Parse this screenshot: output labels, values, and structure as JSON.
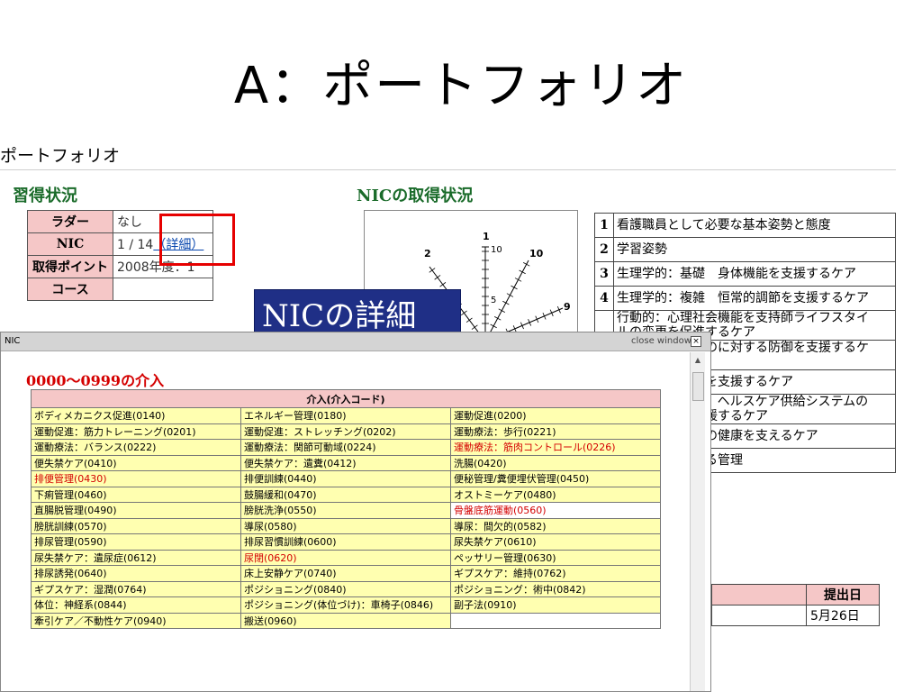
{
  "slide_title": "A：ポートフォリオ",
  "portfolio_heading": "ポートフォリオ",
  "status_heading": "習得状況",
  "status": {
    "rows": [
      {
        "label": "ラダー",
        "value": "なし"
      },
      {
        "label": "NIC",
        "value": "1 / 14",
        "link_text": "（詳細）"
      },
      {
        "label": "取得ポイント",
        "value": "2008年度：1"
      },
      {
        "label": "コース",
        "value": ""
      }
    ]
  },
  "nic_heading": "NICの取得状況",
  "chart_data": {
    "type": "radar",
    "axis_labels": [
      "1",
      "10",
      "9",
      "2"
    ],
    "tick_labels": [
      "10",
      "5"
    ]
  },
  "nic_list": [
    {
      "num": "1",
      "text": "看護職員として必要な基本姿勢と態度"
    },
    {
      "num": "2",
      "text": "学習姿勢"
    },
    {
      "num": "3",
      "text": "生理学的：基礎　身体機能を支援するケア"
    },
    {
      "num": "4",
      "text": "生理学的：複雑　恒常的調節を支援するケア"
    },
    {
      "num": "",
      "text": "行動的：心理社会機能を支持師ライフスタイ\nルの変更を促進するケア"
    },
    {
      "num": "",
      "text": "安全：危険なものに対する防御を支援するケ\nア"
    },
    {
      "num": "",
      "text": "家族：家族単位を支援するケア"
    },
    {
      "num": "",
      "text": "ヘルスシステム：ヘルスケア供給システムの\n効果的利用を支援するケア"
    },
    {
      "num": "",
      "text": "地域：地域社会の健康を支えるケア"
    },
    {
      "num": "",
      "text": "看護業務における管理"
    }
  ],
  "submission": {
    "header": "提出日",
    "date": "5月26日"
  },
  "callout_label": "NICの詳細",
  "popup": {
    "title": "NIC",
    "close_label": "close window",
    "range_title": "0000～0999の介入",
    "table_header": "介入(介入コード)",
    "rows": [
      [
        "ボディメカニクス促進(0140)",
        "エネルギー管理(0180)",
        "運動促進(0200)"
      ],
      [
        "運動促進：筋力トレーニング(0201)",
        "運動促進：ストレッチング(0202)",
        "運動療法：歩行(0221)"
      ],
      [
        "運動療法：バランス(0222)",
        "運動療法：関節可動域(0224)",
        "運動療法：筋肉コントロール(0226)"
      ],
      [
        "便失禁ケア(0410)",
        "便失禁ケア：遺糞(0412)",
        "洗腸(0420)"
      ],
      [
        "排便管理(0430)",
        "排便訓練(0440)",
        "便秘管理/糞便埋伏管理(0450)"
      ],
      [
        "下痢管理(0460)",
        "鼓腸緩和(0470)",
        "オストミーケア(0480)"
      ],
      [
        "直腸脱管理(0490)",
        "膀胱洗浄(0550)",
        "骨盤底筋運動(0560)"
      ],
      [
        "膀胱訓練(0570)",
        "導尿(0580)",
        "導尿：間欠的(0582)"
      ],
      [
        "排尿管理(0590)",
        "排尿習慣訓練(0600)",
        "尿失禁ケア(0610)"
      ],
      [
        "尿失禁ケア：遺尿症(0612)",
        "尿閉(0620)",
        "ペッサリー管理(0630)"
      ],
      [
        "排尿誘発(0640)",
        "床上安静ケア(0740)",
        "ギプスケア：維持(0762)"
      ],
      [
        "ギプスケア：湿潤(0764)",
        "ポジショニング(0840)",
        "ポジショニング：術中(0842)"
      ],
      [
        "体位：神経系(0844)",
        "ポジショニング(体位づけ)：車椅子(0846)",
        "副子法(0910)"
      ],
      [
        "牽引ケア／不動性ケア(0940)",
        "搬送(0960)",
        ""
      ]
    ],
    "red_cells": [
      "2-2",
      "4-0",
      "6-2",
      "9-1"
    ],
    "white_cells": [
      "6-2",
      "13-2"
    ]
  }
}
